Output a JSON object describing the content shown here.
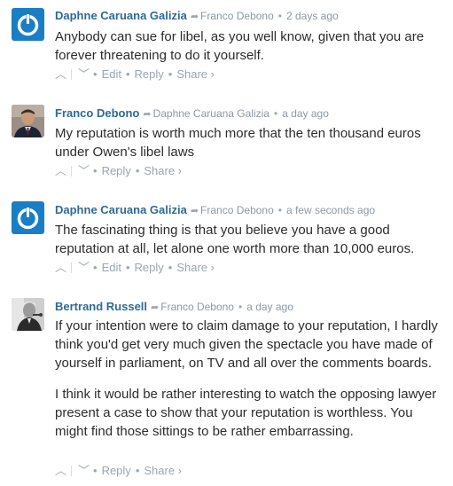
{
  "comments": [
    {
      "author": "Daphne Caruana Galizia",
      "reply_to": "Franco Debono",
      "time": "2 days ago",
      "avatar": "dcg-logo-icon",
      "paragraphs": [
        "Anybody can sue for libel, as you well know, given that you are forever threatening to do it yourself."
      ],
      "actions": [
        "Edit",
        "Reply",
        "Share ›"
      ]
    },
    {
      "author": "Franco Debono",
      "reply_to": "Daphne Caruana Galizia",
      "time": "a day ago",
      "avatar": "man-photo",
      "paragraphs": [
        "My reputation is worth much more that the ten thousand euros under Owen's libel laws"
      ],
      "actions": [
        "Reply",
        "Share ›"
      ]
    },
    {
      "author": "Daphne Caruana Galizia",
      "reply_to": "Franco Debono",
      "time": "a few seconds ago",
      "avatar": "dcg-logo-icon",
      "paragraphs": [
        "The fascinating thing is that you believe you have a good reputation at all, let alone one worth more than 10,000 euros."
      ],
      "actions": [
        "Edit",
        "Reply",
        "Share ›"
      ]
    },
    {
      "author": "Bertrand Russell",
      "reply_to": "Franco Debono",
      "time": "a day ago",
      "avatar": "bw-portrait-photo",
      "paragraphs": [
        "If your intention were to claim damage to your reputation, I hardly think you'd get very much given the spectacle you have made of yourself in parliament, on TV and all over the comments boards.",
        "I think it would be rather interesting to watch the opposing lawyer present a case to show that your reputation is worthless. You might find those sittings to be rather embarrassing."
      ],
      "actions": [
        "Reply",
        "Share ›"
      ]
    }
  ],
  "colors": {
    "author": "#2e6a96",
    "meta": "#8c98a5",
    "body": "#2c2c2c",
    "avatar_blue": "#1a7ec7"
  }
}
